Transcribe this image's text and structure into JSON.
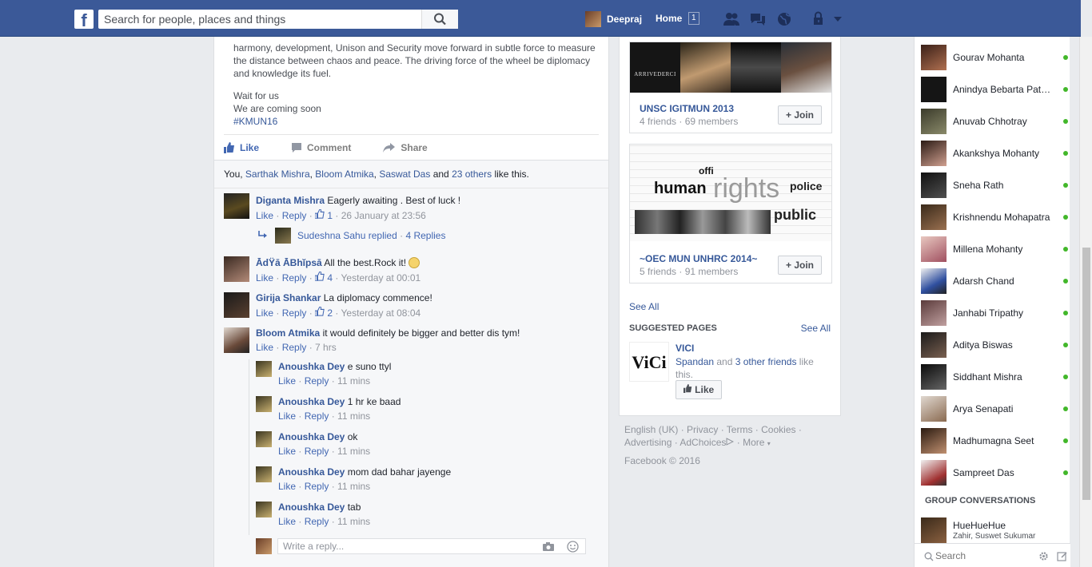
{
  "header": {
    "logo": "f",
    "search_placeholder": "Search for people, places and things",
    "user_name": "Deepraj",
    "home_label": "Home",
    "home_count": "1"
  },
  "post": {
    "text_line1": "harmony, development, Unison and Security move forward in subtle force to measure",
    "text_line2": "the distance between chaos and peace. The driving force of the wheel be diplomacy",
    "text_line3": "and knowledge its fuel.",
    "wait": "Wait for us",
    "coming": "We are coming soon",
    "hashtag": "#KMUN16",
    "actions": {
      "like": "Like",
      "comment": "Comment",
      "share": "Share"
    },
    "likes": {
      "prefix": "You, ",
      "name1": "Sarthak Mishra",
      "name2": "Bloom Atmika",
      "name3": "Saswat Das",
      "and": " and ",
      "others": "23 others",
      "suffix": " like this."
    }
  },
  "comments": [
    {
      "name": "Diganta Mishra",
      "text": "Eagerly awaiting . Best of luck !",
      "like": "Like",
      "reply": "Reply",
      "count": "1",
      "time": "26 January at 23:56"
    },
    {
      "name": "ĀdŸā ĀBhĭpsā",
      "text": "All the best.Rock it!",
      "like": "Like",
      "reply": "Reply",
      "count": "4",
      "time": "Yesterday at 00:01"
    },
    {
      "name": "Girija Shankar",
      "text": "La diplomacy commence!",
      "like": "Like",
      "reply": "Reply",
      "count": "2",
      "time": "Yesterday at 08:04"
    },
    {
      "name": "Bloom Atmika",
      "text": "it would definitely be bigger and better dis tym!",
      "like": "Like",
      "reply": "Reply",
      "time": "7 hrs"
    }
  ],
  "replied": {
    "name": "Sudeshna Sahu replied",
    "sep": " · ",
    "count": "4 Replies"
  },
  "replies": [
    {
      "name": "Anoushka Dey",
      "text": "e suno ttyl",
      "like": "Like",
      "reply": "Reply",
      "time": "11 mins"
    },
    {
      "name": "Anoushka Dey",
      "text": "1 hr ke baad",
      "like": "Like",
      "reply": "Reply",
      "time": "11 mins"
    },
    {
      "name": "Anoushka Dey",
      "text": "ok",
      "like": "Like",
      "reply": "Reply",
      "time": "11 mins"
    },
    {
      "name": "Anoushka Dey",
      "text": "mom dad bahar jayenge",
      "like": "Like",
      "reply": "Reply",
      "time": "11 mins"
    },
    {
      "name": "Anoushka Dey",
      "text": "tab",
      "like": "Like",
      "reply": "Reply",
      "time": "11 mins"
    }
  ],
  "reply_placeholder": "Write a reply...",
  "groups": [
    {
      "name": "UNSC IGITMUN 2013",
      "meta": "4 friends · 69 members",
      "join": "Join",
      "cover_text": "ARRIVEDERCI"
    },
    {
      "name": "~OEC MUN UNHRC 2014~",
      "meta": "5 friends · 91 members",
      "join": "Join",
      "cover_text": "human rights"
    }
  ],
  "see_all": "See All",
  "suggested": {
    "heading": "SUGGESTED PAGES",
    "see_all": "See All",
    "page_name": "VICI",
    "friend": "Spandan",
    "and": " and ",
    "others": "3 other friends",
    "like_this": " like this.",
    "like_btn": "Like",
    "logo_text": "ViCi"
  },
  "footer": {
    "line1": "English (UK) · Privacy · Terms · Cookies ·",
    "line2a": "Advertising · AdChoices",
    "line2b": " · More",
    "copyright": "Facebook © 2016"
  },
  "chat": {
    "contacts": [
      "Gourav Mohanta",
      "Anindya Bebarta Pat…",
      "Anuvab Chhotray",
      "Akankshya Mohanty",
      "Sneha Rath",
      "Krishnendu Mohapatra",
      "Millena Mohanty",
      "Adarsh Chand",
      "Janhabi Tripathy",
      "Aditya Biswas",
      "Siddhant Mishra",
      "Arya Senapati",
      "Madhumagna Seet",
      "Sampreet Das"
    ],
    "group_heading": "GROUP CONVERSATIONS",
    "group_name": "HueHueHue",
    "group_members": "Zahir, Suswet Sukumar",
    "search_placeholder": "Search"
  },
  "colors": {
    "brand": "#3b5998",
    "link": "#365899",
    "online": "#42b72a"
  }
}
